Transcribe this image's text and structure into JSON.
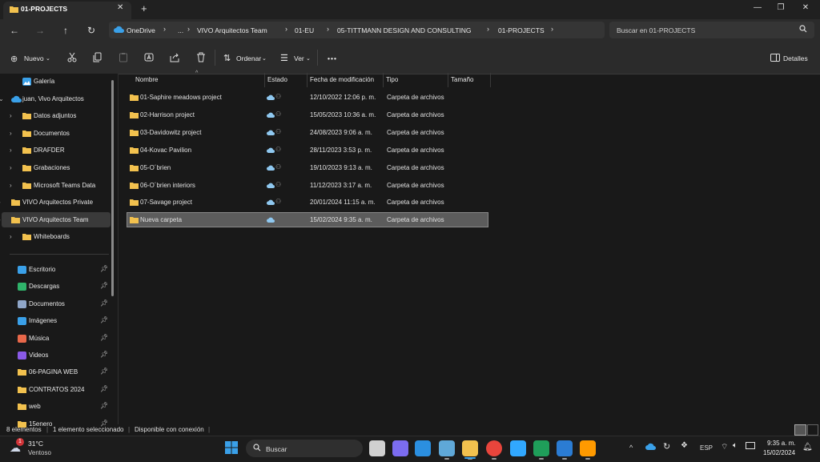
{
  "window": {
    "tab_title": "01-PROJECTS",
    "new_tab": "+",
    "close_tab": "✕"
  },
  "nav": {
    "breadcrumbs": [
      "OneDrive",
      "VIVO Arquitectos Team",
      "01-EU",
      "05-TITTMANN DESIGN AND CONSULTING",
      "01-PROJECTS"
    ],
    "more": "...",
    "search_placeholder": "Buscar en 01-PROJECTS"
  },
  "toolbar": {
    "new_label": "Nuevo",
    "sort_label": "Ordenar",
    "view_label": "Ver",
    "more_label": "•••",
    "details_label": "Detalles"
  },
  "sidebar": {
    "top": [
      {
        "label": "Galería",
        "icon": "gallery-icon",
        "indent": 1,
        "chevron": false
      },
      {
        "label": "juan, Vivo Arquitectos",
        "icon": "onedrive-cloud-icon",
        "indent": 0,
        "chevron": "open"
      },
      {
        "label": "Datos adjuntos",
        "icon": "folder-icon",
        "indent": 1,
        "chevron": true
      },
      {
        "label": "Documentos",
        "icon": "folder-icon",
        "indent": 1,
        "chevron": true
      },
      {
        "label": "DRAFDER",
        "icon": "folder-icon",
        "indent": 1,
        "chevron": true
      },
      {
        "label": "Grabaciones",
        "icon": "folder-icon",
        "indent": 1,
        "chevron": true
      },
      {
        "label": "Microsoft Teams Data",
        "icon": "folder-icon",
        "indent": 1,
        "chevron": true
      },
      {
        "label": "VIVO Arquitectos Private",
        "icon": "folder-icon",
        "indent": 0,
        "chevron": true
      },
      {
        "label": "VIVO Arquitectos Team",
        "icon": "folder-icon",
        "indent": 0,
        "chevron": true,
        "selected": true
      },
      {
        "label": "Whiteboards",
        "icon": "folder-icon",
        "indent": 1,
        "chevron": true
      }
    ],
    "pinned": [
      {
        "label": "Escritorio",
        "icon": "desktop-icon",
        "color": "#3aa0e8"
      },
      {
        "label": "Descargas",
        "icon": "download-icon",
        "color": "#2fb36a"
      },
      {
        "label": "Documentos",
        "icon": "documents-icon",
        "color": "#8fa6c8"
      },
      {
        "label": "Imágenes",
        "icon": "pictures-icon",
        "color": "#3aa0e8"
      },
      {
        "label": "Música",
        "icon": "music-icon",
        "color": "#e8684a"
      },
      {
        "label": "Videos",
        "icon": "videos-icon",
        "color": "#8a5ae8"
      },
      {
        "label": "06-PAGINA WEB",
        "icon": "folder-icon",
        "color": "#f2c14e"
      },
      {
        "label": "CONTRATOS 2024",
        "icon": "folder-icon",
        "color": "#f2c14e"
      },
      {
        "label": "web",
        "icon": "folder-icon",
        "color": "#f2c14e"
      },
      {
        "label": "15enero",
        "icon": "folder-icon",
        "color": "#f2c14e"
      }
    ]
  },
  "columns": {
    "name": "Nombre",
    "status": "Estado",
    "modified": "Fecha de modificación",
    "type": "Tipo",
    "size": "Tamaño"
  },
  "files": [
    {
      "name": "01-Saphire meadows project",
      "modified": "12/10/2022 12:06 p. m.",
      "type": "Carpeta de archivos",
      "shared": true
    },
    {
      "name": "02-Harrison project",
      "modified": "15/05/2023 10:36 a. m.",
      "type": "Carpeta de archivos",
      "shared": true
    },
    {
      "name": "03-Davidowitz project",
      "modified": "24/08/2023 9:06 a. m.",
      "type": "Carpeta de archivos",
      "shared": true
    },
    {
      "name": "04-Kovac Pavilion",
      "modified": "28/11/2023 3:53 p. m.",
      "type": "Carpeta de archivos",
      "shared": true
    },
    {
      "name": "05-O´brien",
      "modified": "19/10/2023 9:13 a. m.",
      "type": "Carpeta de archivos",
      "shared": true
    },
    {
      "name": "06-O´brien interiors",
      "modified": "11/12/2023 3:17 a. m.",
      "type": "Carpeta de archivos",
      "shared": true
    },
    {
      "name": "07-Savage project",
      "modified": "20/01/2024 11:15 a. m.",
      "type": "Carpeta de archivos",
      "shared": true
    },
    {
      "name": "Nueva carpeta",
      "modified": "15/02/2024 9:35 a. m.",
      "type": "Carpeta de archivos",
      "shared": false,
      "selected": true
    }
  ],
  "status_bar": {
    "count": "8 elementos",
    "selected": "1 elemento seleccionado",
    "availability": "Disponible con conexión"
  },
  "taskbar": {
    "weather_temp": "31°C",
    "weather_desc": "Ventoso",
    "weather_badge": "1",
    "search_label": "Buscar",
    "lang": "ESP",
    "time": "9:35 a. m.",
    "date": "15/02/2024",
    "apps": [
      {
        "name": "windows-start-icon",
        "color": "#3aa0e8"
      },
      {
        "name": "task-view-icon",
        "color": "#d0d0d0"
      },
      {
        "name": "teams-chat-icon",
        "color": "#7b6cf0"
      },
      {
        "name": "mail-icon",
        "color": "#2b8fe0"
      },
      {
        "name": "snipping-tool-icon",
        "color": "#5fa8d8"
      },
      {
        "name": "file-explorer-icon",
        "color": "#f2c14e"
      },
      {
        "name": "chrome-icon",
        "color": "#e8453c"
      },
      {
        "name": "photoshop-icon",
        "color": "#31a8ff"
      },
      {
        "name": "excel-icon",
        "color": "#1f9e5a"
      },
      {
        "name": "word-icon",
        "color": "#2b7cd3"
      },
      {
        "name": "illustrator-icon",
        "color": "#ff9a00"
      }
    ]
  },
  "colors": {
    "accent": "#3aa0e8",
    "folder": "#f2c14e",
    "selection": "#5c5c5c"
  }
}
